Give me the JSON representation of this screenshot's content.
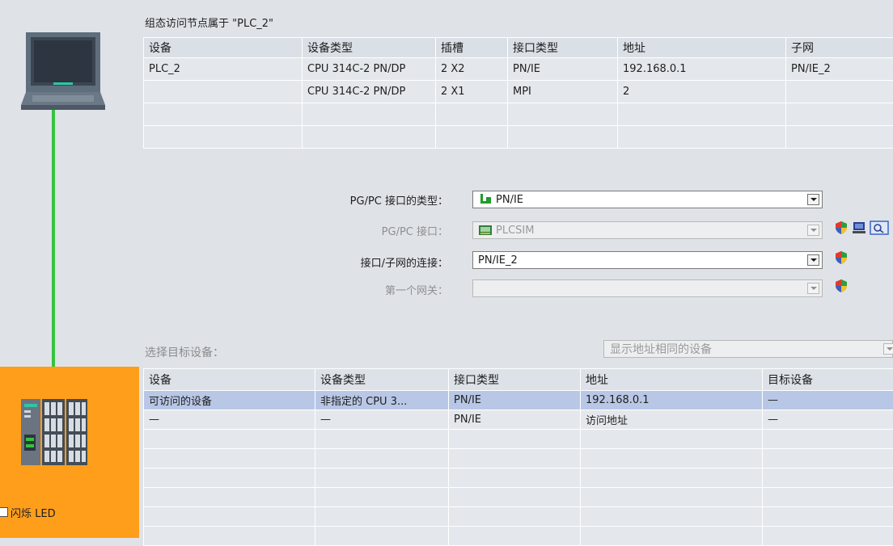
{
  "config_title": "组态访问节点属于 \"PLC_2\"",
  "config_table": {
    "headers": [
      "设备",
      "设备类型",
      "插槽",
      "接口类型",
      "地址",
      "子网"
    ],
    "rows": [
      [
        "PLC_2",
        "CPU 314C-2 PN/DP",
        "2 X2",
        "PN/IE",
        "192.168.0.1",
        "PN/IE_2"
      ],
      [
        "",
        "CPU 314C-2 PN/DP",
        "2 X1",
        "MPI",
        "2",
        ""
      ],
      [
        "",
        "",
        "",
        "",
        "",
        ""
      ],
      [
        "",
        "",
        "",
        "",
        "",
        ""
      ]
    ]
  },
  "form": {
    "pgpc_type": {
      "label": "PG/PC 接口的类型：",
      "value": "PN/IE",
      "icon": "ethernet-plug-icon"
    },
    "pgpc_interface": {
      "label": "PG/PC 接口：",
      "value": "PLCSIM",
      "icon": "plcsim-card-icon",
      "disabled": true
    },
    "subnet_connection": {
      "label": "接口/子网的连接：",
      "value": "PN/IE_2"
    },
    "first_gateway": {
      "label": "第一个网关：",
      "value": "",
      "disabled": true
    }
  },
  "target": {
    "label": "选择目标设备：",
    "filter_value": "显示地址相同的设备",
    "headers": [
      "设备",
      "设备类型",
      "接口类型",
      "地址",
      "目标设备"
    ],
    "rows": [
      [
        "可访问的设备",
        "非指定的 CPU 3...",
        "PN/IE",
        "192.168.0.1",
        "—"
      ],
      [
        "—",
        "—",
        "PN/IE",
        "访问地址",
        "—"
      ],
      [
        "",
        "",
        "",
        "",
        ""
      ],
      [
        "",
        "",
        "",
        "",
        ""
      ],
      [
        "",
        "",
        "",
        "",
        ""
      ],
      [
        "",
        "",
        "",
        "",
        ""
      ],
      [
        "",
        "",
        "",
        "",
        ""
      ],
      [
        "",
        "",
        "",
        "",
        ""
      ]
    ],
    "selected_row": 0
  },
  "blink_led_label": "闪烁 LED",
  "colors": {
    "background": "#dfe3e8",
    "link_line": "#34c43c",
    "target_panel": "#ff9e1b",
    "selected_row": "#b9c7e6"
  }
}
